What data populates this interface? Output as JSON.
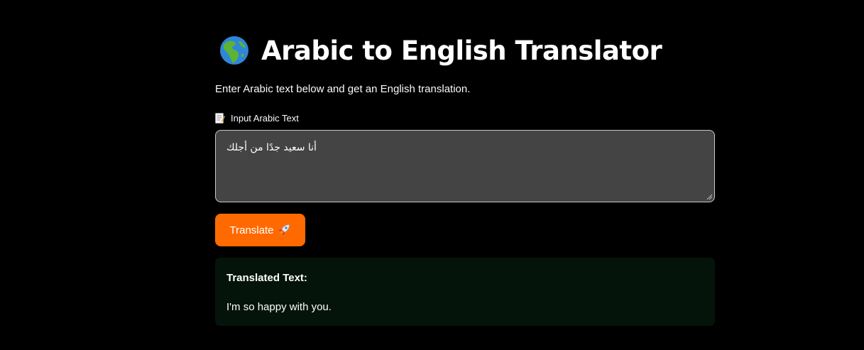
{
  "header": {
    "icon": "globe-icon",
    "title": "Arabic to English Translator",
    "subtitle": "Enter Arabic text below and get an English translation."
  },
  "input": {
    "label_icon": "memo-icon",
    "label": "Input Arabic Text",
    "value": "أنا سعيد جدًا من أجلك"
  },
  "translate_button": {
    "label": "Translate",
    "icon": "rocket-icon",
    "color": "#ff6a00"
  },
  "result": {
    "heading": "Translated Text:",
    "text": "I'm so happy with you."
  },
  "colors": {
    "background": "#000000",
    "textarea_bg": "#444444",
    "result_bg": "#04140b"
  }
}
